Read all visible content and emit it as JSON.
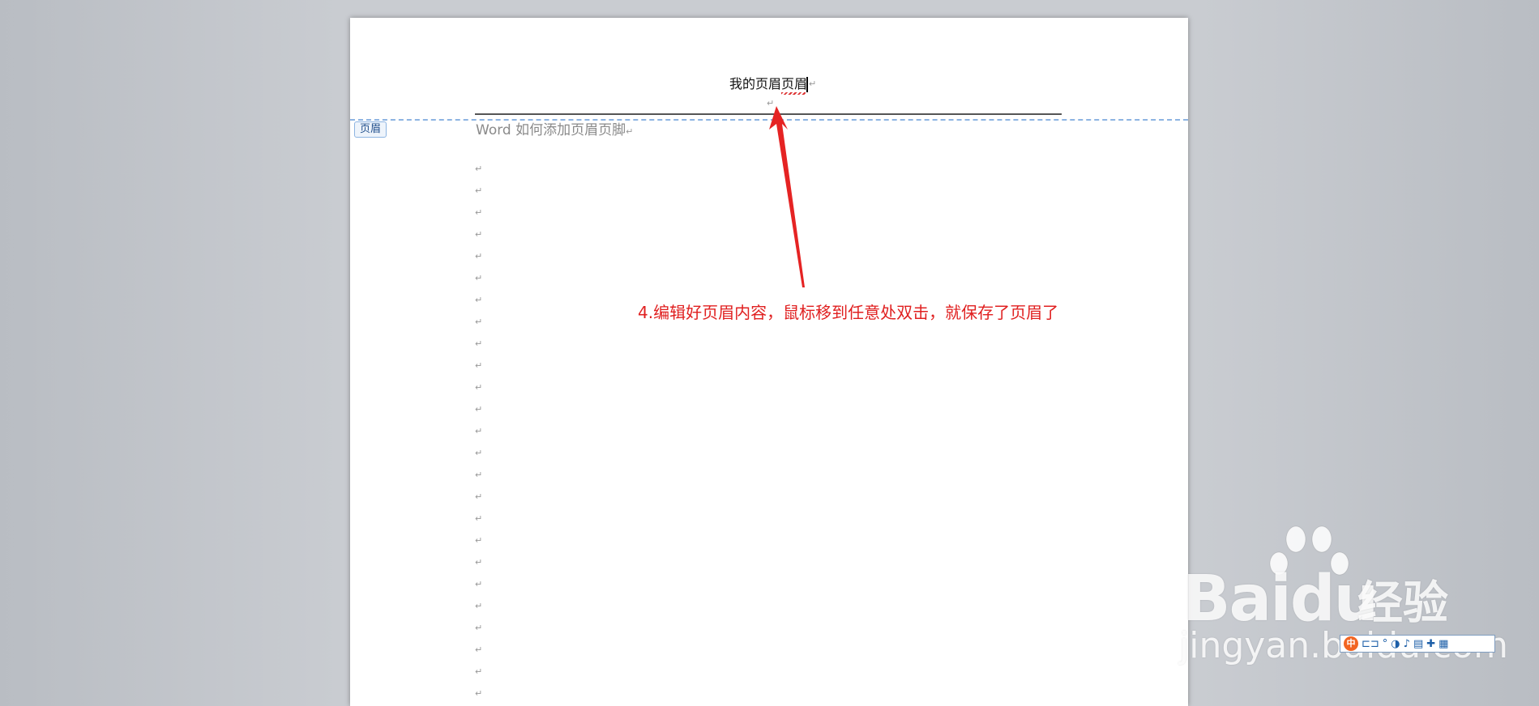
{
  "document": {
    "header_text": "我的页眉页眉",
    "header_tag_label": "页眉",
    "body_first_line": "Word 如何添加页眉页脚",
    "paragraph_mark": "↵",
    "empty_paragraph_count": 25
  },
  "annotation": {
    "text": "4.编辑好页眉内容，鼠标移到任意处双击，就保存了页眉了",
    "color": "#e02020"
  },
  "watermark": {
    "brand": "Bai",
    "brand_tail": "du",
    "cn": "经验",
    "domain": "jingyan.baidu.com"
  },
  "ime_toolbar": {
    "logo_label": "中",
    "icons": [
      "punctuation-icon",
      "degree-icon",
      "voice-icon",
      "mic-icon",
      "keyboard-icon",
      "skin-icon",
      "grid-icon"
    ]
  }
}
